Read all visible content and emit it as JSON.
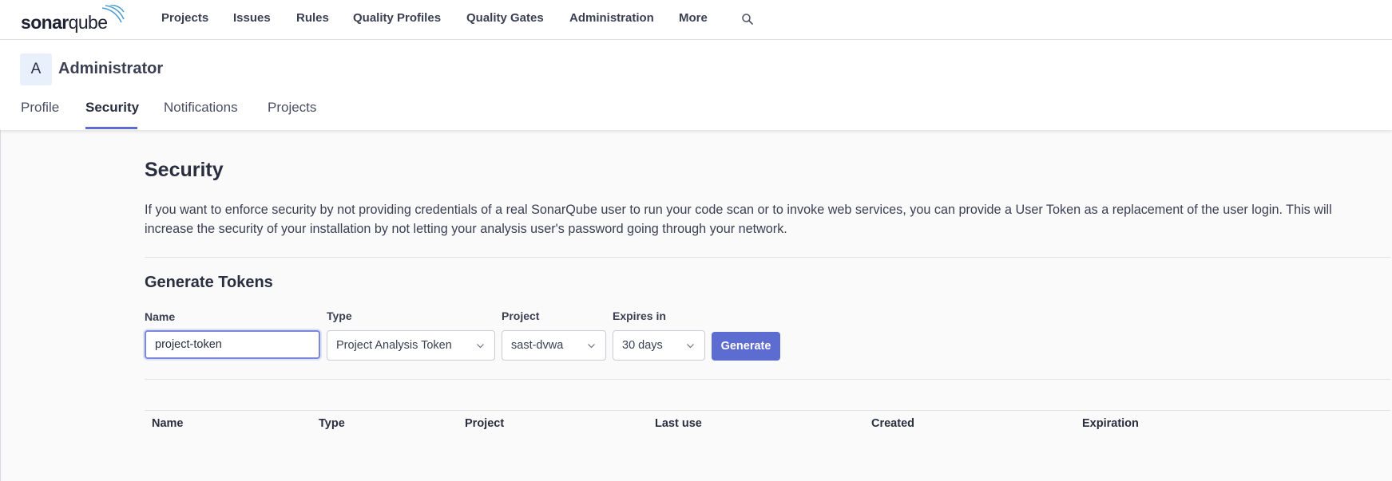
{
  "logo": {
    "text_bold": "sonar",
    "text_regular": "qube",
    "icon": "sonar-waves-icon"
  },
  "topnav": {
    "items": [
      "Projects",
      "Issues",
      "Rules",
      "Quality Profiles",
      "Quality Gates",
      "Administration",
      "More"
    ],
    "search_icon": "search-icon"
  },
  "account": {
    "avatar_letter": "A",
    "name": "Administrator",
    "tabs": [
      "Profile",
      "Security",
      "Notifications",
      "Projects"
    ],
    "active_tab": "Security"
  },
  "security": {
    "title": "Security",
    "description": "If you want to enforce security by not providing credentials of a real SonarQube user to run your code scan or to invoke web services, you can provide a User Token as a replacement of the user login. This will increase the security of your installation by not letting your analysis user's password going through your network."
  },
  "generate": {
    "title": "Generate Tokens",
    "name_label": "Name",
    "name_value": "project-token",
    "type_label": "Type",
    "type_value": "Project Analysis Token",
    "project_label": "Project",
    "project_value": "sast-dvwa",
    "expires_label": "Expires in",
    "expires_value": "30 days",
    "button_label": "Generate"
  },
  "tokens_table": {
    "columns": [
      "Name",
      "Type",
      "Project",
      "Last use",
      "Created",
      "Expiration"
    ]
  },
  "colors": {
    "accent": "#5d6cd0",
    "nav_text": "#3b3f52",
    "avatar_bg": "#e8f1fb",
    "main_bg": "#fafafa"
  }
}
